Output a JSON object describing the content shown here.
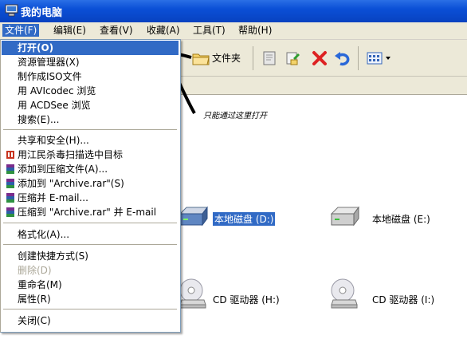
{
  "window": {
    "title": "我的电脑"
  },
  "menubar": [
    {
      "label": "文件(F)"
    },
    {
      "label": "编辑(E)"
    },
    {
      "label": "查看(V)"
    },
    {
      "label": "收藏(A)"
    },
    {
      "label": "工具(T)"
    },
    {
      "label": "帮助(H)"
    }
  ],
  "toolbar": {
    "folders_label": "文件夹"
  },
  "context_menu": [
    {
      "label": "打开(O)"
    },
    {
      "label": "资源管理器(X)"
    },
    {
      "label": "制作成ISO文件"
    },
    {
      "label": "用 AVIcodec 浏览"
    },
    {
      "label": "用 ACDSee 浏览"
    },
    {
      "label": "搜索(E)..."
    },
    {
      "label": "共享和安全(H)..."
    },
    {
      "label": "用江民杀毒扫描选中目标"
    },
    {
      "label": "添加到压缩文件(A)..."
    },
    {
      "label": "添加到 \"Archive.rar\"(S)"
    },
    {
      "label": "压缩并 E-mail..."
    },
    {
      "label": "压缩到 \"Archive.rar\" 并 E-mail"
    },
    {
      "label": "格式化(A)..."
    },
    {
      "label": "创建快捷方式(S)"
    },
    {
      "label": "删除(D)"
    },
    {
      "label": "重命名(M)"
    },
    {
      "label": "属性(R)"
    },
    {
      "label": "关闭(C)"
    }
  ],
  "drives": [
    {
      "label": "本地磁盘 (D:)"
    },
    {
      "label": "本地磁盘 (E:)"
    },
    {
      "label": "CD 驱动器 (H:)"
    },
    {
      "label": "CD 驱动器 (I:)"
    }
  ],
  "annotation": "只能通过这里打开"
}
